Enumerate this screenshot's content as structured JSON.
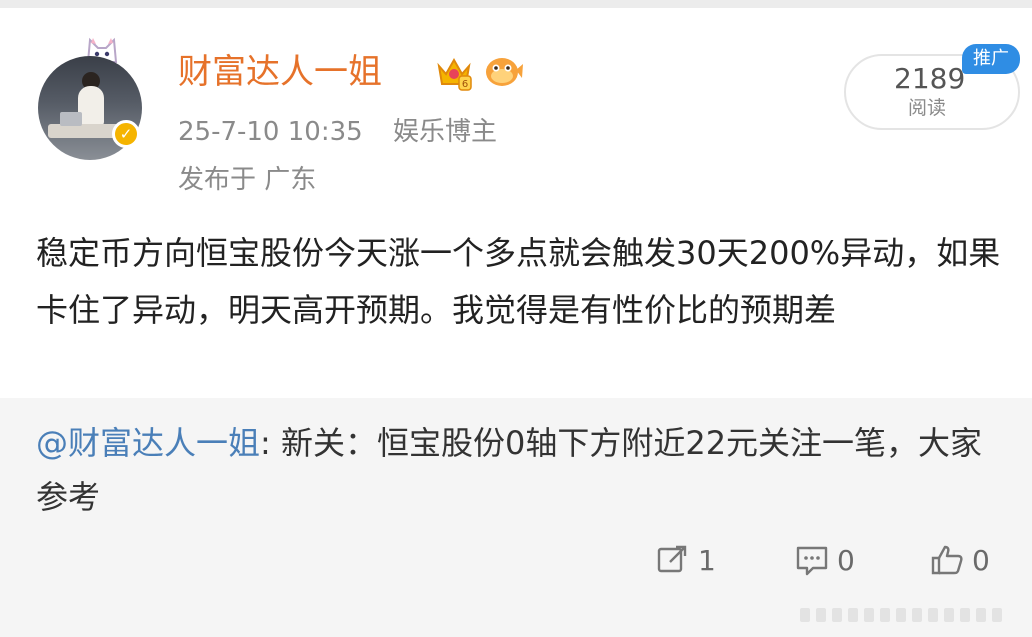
{
  "post": {
    "author": {
      "name": "财富达人一姐",
      "verified": true,
      "avatar_icon": "avatar-photo",
      "badges": [
        "cat-icon",
        "crown-level-icon",
        "fish-icon"
      ],
      "verified_icon": "verified-badge-icon"
    },
    "timestamp": "25-7-10 10:35",
    "role": "娱乐博主",
    "location": "发布于 广东",
    "stats": {
      "read_count": "2189",
      "read_label": "阅读"
    },
    "promo_label": "推广",
    "body": "稳定币方向恒宝股份今天涨一个多点就会触发30天200%异动，如果卡住了异动，明天高开预期。我觉得是有性价比的预期差"
  },
  "repost": {
    "mention": "@财富达人一姐",
    "text": ": 新关：恒宝股份0轴下方附近22元关注一笔，大家参考"
  },
  "actions": [
    {
      "name": "share",
      "icon": "share-icon",
      "count": "1"
    },
    {
      "name": "comment",
      "icon": "comment-icon",
      "count": "0"
    },
    {
      "name": "like",
      "icon": "like-icon",
      "count": "0"
    }
  ],
  "colors": {
    "author_name": "#e6722a",
    "mention": "#4a7fb8",
    "promo": "#2f8de4",
    "verified": "#f5b400",
    "meta": "#8a8a8a",
    "repost_bg": "#f5f5f5"
  }
}
